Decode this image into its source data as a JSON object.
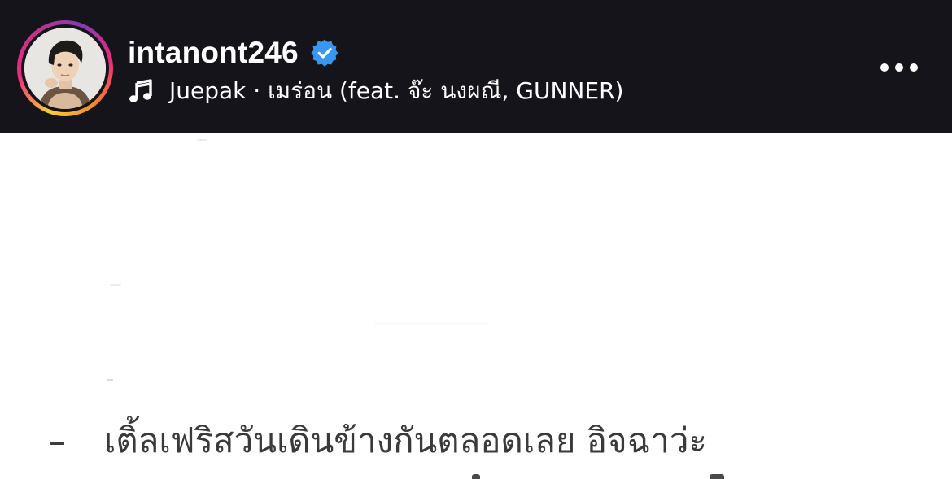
{
  "header": {
    "username": "intanont246",
    "verified": true,
    "music_track": "Juepak · เมร่อน (feat. จ๊ะ นงผณี, GUNNER)",
    "more_label": "More options"
  },
  "content": {
    "caption_dash": "–",
    "caption_line": "เติ้ลเฟริสวันเดินข้างกันตลอดเลย อิจฉาว่ะ"
  },
  "colors": {
    "header_bg": "#14141a",
    "verified_blue": "#3897f0",
    "text_white": "#ffffff",
    "caption_text": "#3a3a3a"
  },
  "icons": [
    "avatar",
    "verified-badge-icon",
    "music-note-icon",
    "more-options-icon"
  ]
}
